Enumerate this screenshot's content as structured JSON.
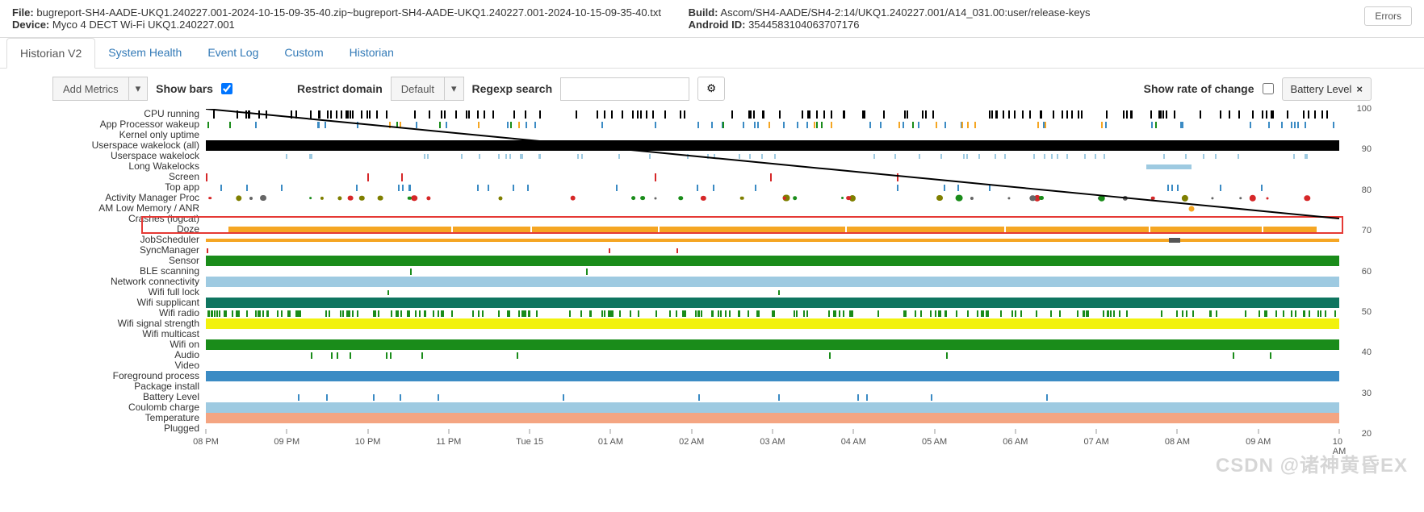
{
  "header": {
    "file_label": "File:",
    "file_value": "bugreport-SH4-AADE-UKQ1.240227.001-2024-10-15-09-35-40.zip~bugreport-SH4-AADE-UKQ1.240227.001-2024-10-15-09-35-40.txt",
    "device_label": "Device:",
    "device_value": "Myco 4 DECT Wi-Fi UKQ1.240227.001",
    "build_label": "Build:",
    "build_value": "Ascom/SH4-AADE/SH4-2:14/UKQ1.240227.001/A14_031.00:user/release-keys",
    "android_id_label": "Android ID:",
    "android_id_value": "3544583104063707176",
    "errors_btn": "Errors"
  },
  "tabs": [
    {
      "label": "Historian V2",
      "active": true
    },
    {
      "label": "System Health",
      "active": false
    },
    {
      "label": "Event Log",
      "active": false
    },
    {
      "label": "Custom",
      "active": false
    },
    {
      "label": "Historian",
      "active": false
    }
  ],
  "toolbar": {
    "add_metrics": "Add Metrics",
    "show_bars_label": "Show bars",
    "show_bars_checked": true,
    "restrict_domain_label": "Restrict domain",
    "restrict_domain_value": "Default",
    "regexp_label": "Regexp search",
    "regexp_value": "",
    "rate_label": "Show rate of change",
    "rate_checked": false,
    "selected_metric": "Battery Level"
  },
  "rows": [
    "CPU running",
    "App Processor wakeup",
    "Kernel only uptime",
    "Userspace wakelock (all)",
    "Userspace wakelock",
    "Long Wakelocks",
    "Screen",
    "Top app",
    "Activity Manager Proc",
    "AM Low Memory / ANR",
    "Crashes (logcat)",
    "Doze",
    "JobScheduler",
    "SyncManager",
    "Sensor",
    "BLE scanning",
    "Network connectivity",
    "Wifi full lock",
    "Wifi supplicant",
    "Wifi radio",
    "Wifi signal strength",
    "Wifi multicast",
    "Wifi on",
    "Audio",
    "Video",
    "Foreground process",
    "Package install",
    "Battery Level",
    "Coulomb charge",
    "Temperature",
    "Plugged"
  ],
  "y_ticks": [
    100,
    90,
    80,
    70,
    60,
    50,
    40,
    30,
    20
  ],
  "x_ticks": [
    "08 PM",
    "09 PM",
    "10 PM",
    "11 PM",
    "Tue 15",
    "01 AM",
    "02 AM",
    "03 AM",
    "04 AM",
    "05 AM",
    "06 AM",
    "07 AM",
    "08 AM",
    "09 AM",
    "10 AM"
  ],
  "chart_data": {
    "type": "timeline",
    "x_range": [
      "2024-10-14 20:00",
      "2024-10-15 10:00"
    ],
    "battery_level": {
      "start": 100,
      "end": 73,
      "y_range": [
        0,
        100
      ]
    },
    "highlighted_row": "Doze",
    "full_bars": {
      "Userspace wakelock (all)": "#000",
      "Sensor": "#1a8c1a",
      "Network connectivity": "#9ecae1",
      "Wifi supplicant": "#0f7560",
      "Wifi signal strength": "#f2f20d",
      "Wifi on": "#1a8c1a",
      "Foreground process": "#3b8bc4",
      "Coulomb charge": "#9ecae1",
      "Temperature": "#f4a582",
      "Plugged": "#fff"
    },
    "doze_color": "#f5a623",
    "jobscheduler_color": "#f5a623"
  },
  "watermark": "CSDN @诸神黄昏EX"
}
